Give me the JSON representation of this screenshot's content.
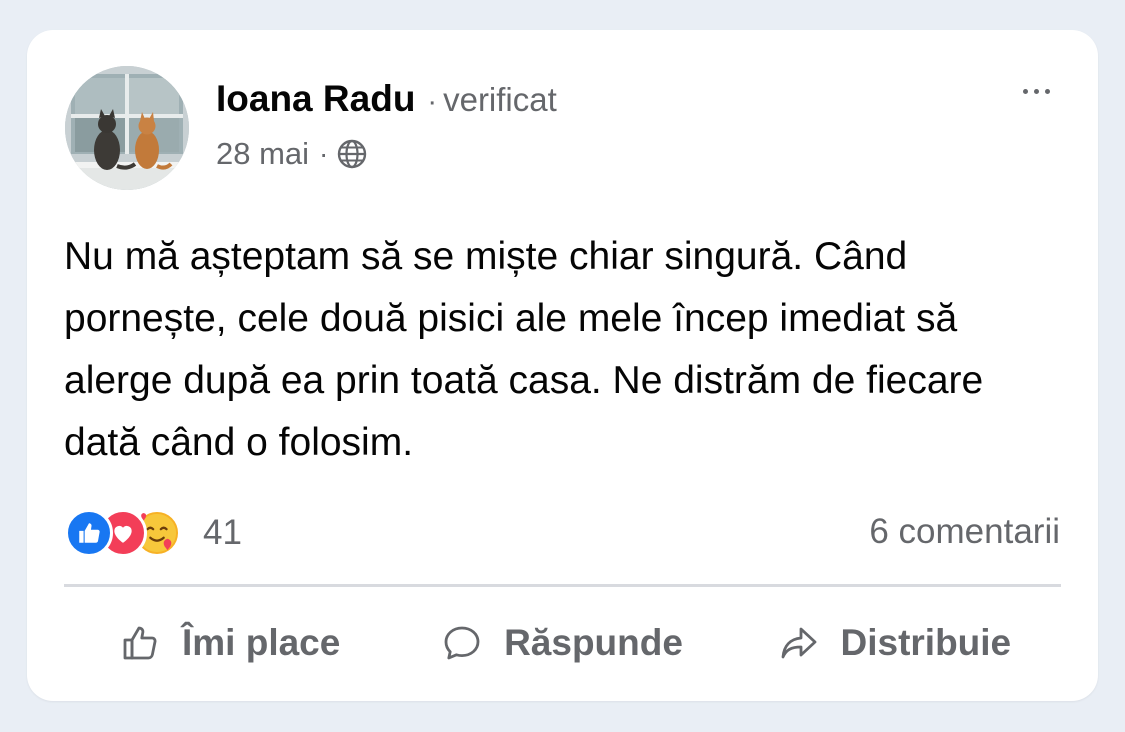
{
  "post": {
    "author": "Ioana Radu",
    "separator": "·",
    "verified_label": "verificat",
    "date": "28 mai",
    "meta_separator": "·",
    "privacy_icon": "globe-icon",
    "text": "Nu mă așteptam să se miște chiar singură. Când pornește, cele două pisici ale mele încep imediat să alerge după ea prin toată casa. Ne distrăm de fiecare dată când o folosim."
  },
  "reactions": {
    "icons": [
      "like-reaction-icon",
      "love-reaction-icon",
      "care-reaction-icon"
    ],
    "count": "41",
    "comments": "6 comentarii"
  },
  "actions": {
    "like": "Îmi place",
    "reply": "Răspunde",
    "share": "Distribuie"
  },
  "colors": {
    "like_blue": "#1877f2",
    "love_red": "#f33e58",
    "care_yellow": "#f7b125",
    "secondary_text": "#65676b",
    "background": "#e9eef5"
  }
}
